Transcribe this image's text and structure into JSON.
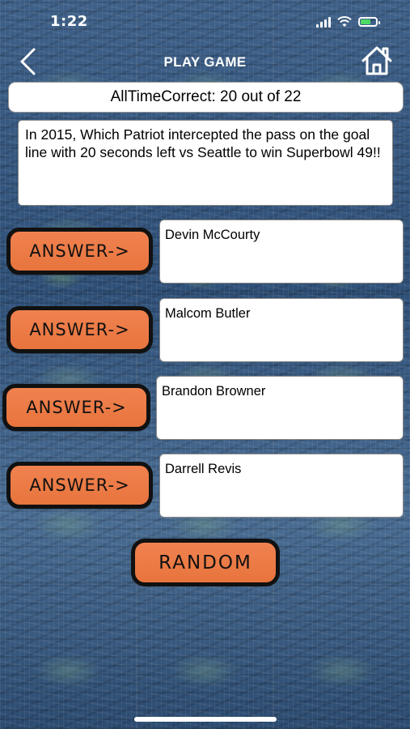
{
  "status_bar": {
    "time": "1:22"
  },
  "nav": {
    "title": "PLAY GAME"
  },
  "score": {
    "text": "AllTimeCorrect: 20 out of 22"
  },
  "question": {
    "text": "In 2015, Which Patriot intercepted the pass on the goal line with 20 seconds left vs Seattle to win Superbowl 49!!"
  },
  "answers": [
    {
      "button_label": "ANSWER->",
      "text": "Devin McCourty"
    },
    {
      "button_label": "ANSWER->",
      "text": "Malcom Butler"
    },
    {
      "button_label": "ANSWER->",
      "text": "Brandon Browner"
    },
    {
      "button_label": "ANSWER->",
      "text": "Darrell Revis"
    }
  ],
  "random_button": {
    "label": "RANDOM"
  },
  "colors": {
    "button_orange": "#e8743d",
    "battery_green": "#4cd964",
    "background_blue": "#3d5f84"
  }
}
